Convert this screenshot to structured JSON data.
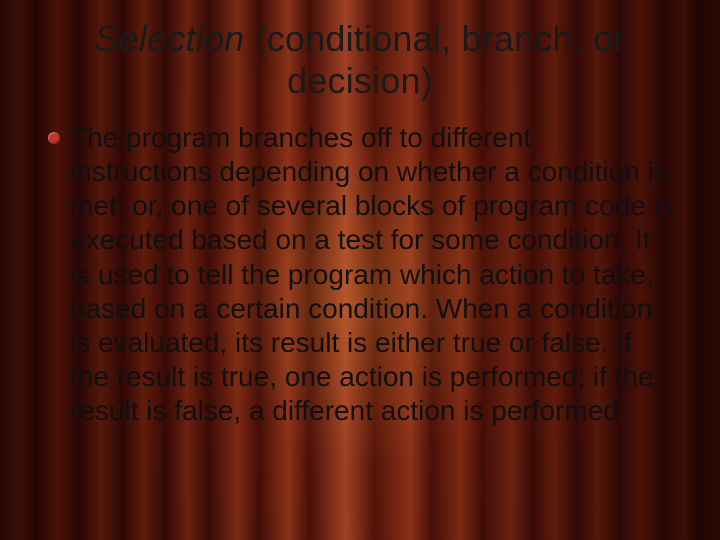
{
  "title": {
    "emphasis": "Selection",
    "rest": " (conditional, branch, or decision)"
  },
  "bullet_icon": "circle-bullet",
  "body": "The program branches off to different instructions depending on whether a condition is met; or, one of several blocks of program code is executed based on a test for some condition. It is used to tell the program which action to take, based on a certain condition. When a condition is evaluated, its result is either true or false. If the result is true, one action is performed; if the result is false, a different action is performed"
}
